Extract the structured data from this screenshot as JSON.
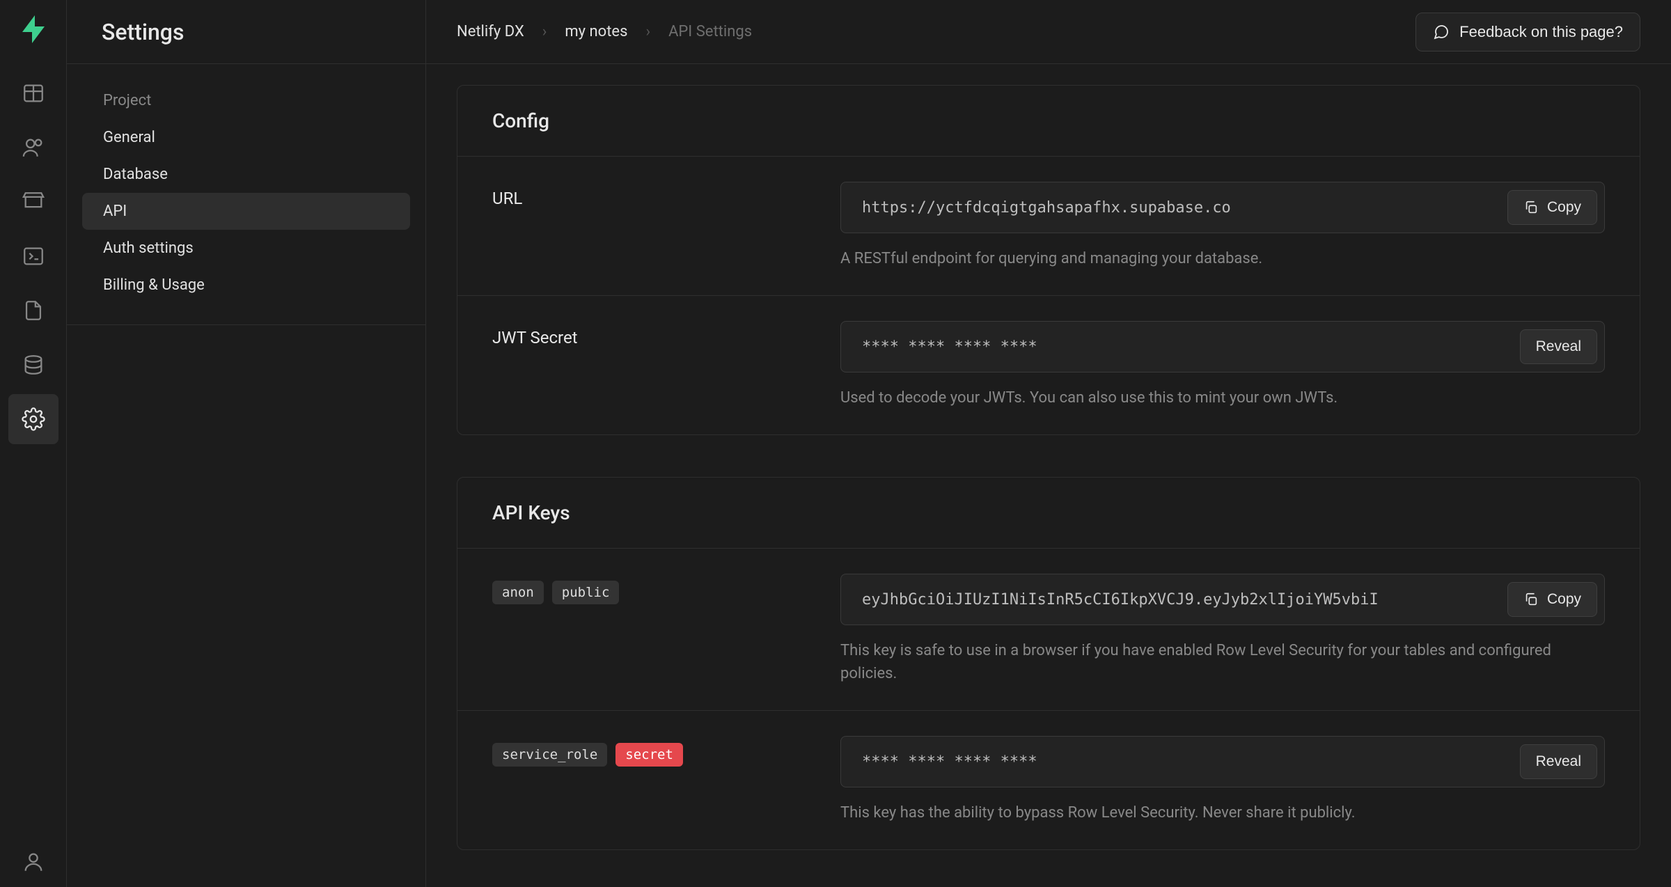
{
  "page_title": "Settings",
  "breadcrumb": {
    "org": "Netlify DX",
    "project": "my notes",
    "page": "API Settings"
  },
  "feedback_label": "Feedback on this page?",
  "sidebar": {
    "heading": "Project",
    "items": [
      {
        "label": "General"
      },
      {
        "label": "Database"
      },
      {
        "label": "API"
      },
      {
        "label": "Auth settings"
      },
      {
        "label": "Billing & Usage"
      }
    ]
  },
  "config": {
    "title": "Config",
    "url": {
      "label": "URL",
      "value": "https://yctfdcqigtgahsapafhx.supabase.co",
      "action": "Copy",
      "hint": "A RESTful endpoint for querying and managing your database."
    },
    "jwt": {
      "label": "JWT Secret",
      "value": "**** **** **** ****",
      "action": "Reveal",
      "hint": "Used to decode your JWTs. You can also use this to mint your own JWTs."
    }
  },
  "api_keys": {
    "title": "API Keys",
    "anon": {
      "tag1": "anon",
      "tag2": "public",
      "value": "eyJhbGciOiJIUzI1NiIsInR5cCI6IkpXVCJ9.eyJyb2xlIjoiYW5vbiI",
      "action": "Copy",
      "hint": "This key is safe to use in a browser if you have enabled Row Level Security for your tables and configured policies."
    },
    "service": {
      "tag1": "service_role",
      "tag2": "secret",
      "value": "**** **** **** ****",
      "action": "Reveal",
      "hint": "This key has the ability to bypass Row Level Security. Never share it publicly."
    }
  }
}
